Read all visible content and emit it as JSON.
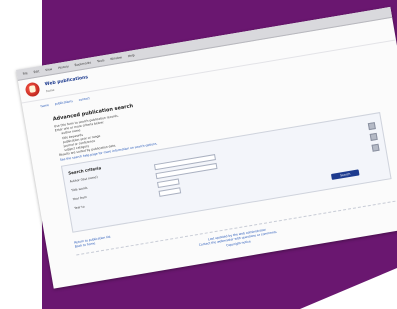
{
  "browser": {
    "menu": [
      "File",
      "Edit",
      "View",
      "History",
      "Bookmarks",
      "Tools",
      "Window",
      "Help"
    ]
  },
  "header": {
    "title": "Web publications",
    "subtitle": "home"
  },
  "nav": [
    "home",
    "publications",
    "contact"
  ],
  "main": {
    "heading": "Advanced publication search",
    "intro_lines": [
      "Use this form to search publication records.",
      "Enter one or more criteria below:"
    ],
    "bullets": [
      "author name",
      "title keywords",
      "publication year or range",
      "journal or conference",
      "subject category"
    ],
    "note": "Results are sorted by publication date.",
    "help_link": "See the search help page for more information on search options."
  },
  "form": {
    "title": "Search criteria",
    "fields": [
      {
        "label": "Author (last name)",
        "value": ""
      },
      {
        "label": "Title words",
        "value": ""
      },
      {
        "label": "Year from",
        "value": ""
      },
      {
        "label": "Year to",
        "value": ""
      }
    ],
    "submit_label": "Search"
  },
  "links": [
    "Return to publication list",
    "Back to home"
  ],
  "footer": {
    "lines": [
      "Last updated by the web administrator",
      "Contact the webmaster with questions or comments",
      "Copyright notice"
    ]
  },
  "colors": {
    "backdrop": "#6a1770",
    "link": "#1a4fb5",
    "button": "#1d3b8f"
  }
}
